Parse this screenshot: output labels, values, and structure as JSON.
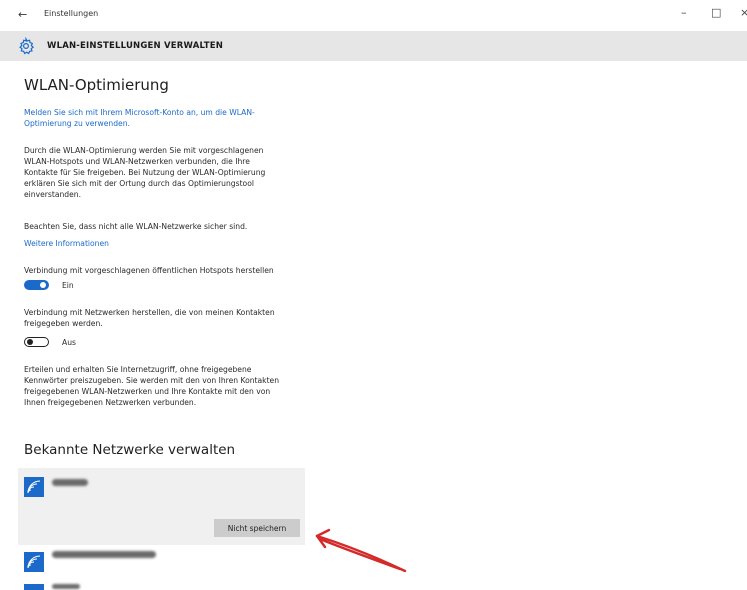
{
  "window": {
    "title": "Einstellungen",
    "back_glyph": "←",
    "minimize_glyph": "–",
    "maximize_glyph": "□",
    "close_glyph": "×"
  },
  "header": {
    "title": "WLAN-EINSTELLUNGEN VERWALTEN",
    "icon": "gear-icon"
  },
  "wlan_opt": {
    "heading": "WLAN-Optimierung",
    "signin_link_l1": "Melden Sie sich mit Ihrem Microsoft-Konto an, um die WLAN-",
    "signin_link_l2": "Optimierung zu verwenden.",
    "desc_l1": "Durch die WLAN-Optimierung werden Sie mit vorgeschlagenen",
    "desc_l2": "WLAN-Hotspots und WLAN-Netzwerken verbunden, die Ihre",
    "desc_l3": "Kontakte für Sie freigeben. Bei Nutzung der WLAN-Optimierung",
    "desc_l4": "erklären Sie sich mit der Ortung durch das Optimierungstool",
    "desc_l5": "einverstanden.",
    "warning": "Beachten Sie, dass nicht alle WLAN-Netzwerke sicher sind.",
    "more_info_link": "Weitere Informationen",
    "hotspots_label": "Verbindung mit vorgeschlagenen öffentlichen Hotspots herstellen",
    "hotspots_state": "Ein",
    "contacts_label_l1": "Verbindung mit Netzwerken herstellen, die von meinen Kontakten",
    "contacts_label_l2": "freigegeben werden.",
    "contacts_state": "Aus",
    "share_l1": "Erteilen und erhalten Sie Internetzugriff, ohne freigegebene",
    "share_l2": "Kennwörter preiszugeben. Sie werden mit den von Ihren Kontakten",
    "share_l3": "freigegebenen WLAN-Netzwerken und Ihre Kontakte mit den von",
    "share_l4": "Ihnen freigegebenen Netzwerken verbunden."
  },
  "known_networks": {
    "heading": "Bekannte Netzwerke verwalten",
    "forget_button": "Nicht speichern"
  },
  "colors": {
    "accent": "#1b6ac9",
    "header_bg": "#e6e6e6",
    "selected_bg": "#f0f0f0",
    "annotation_arrow": "#d42a2a"
  }
}
